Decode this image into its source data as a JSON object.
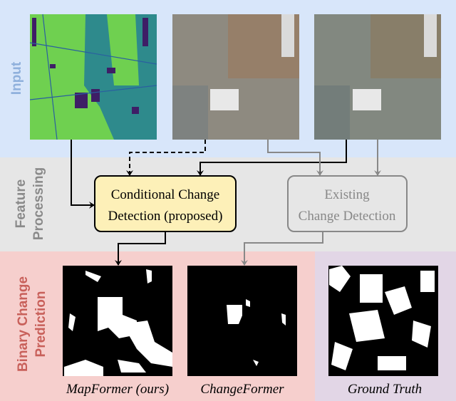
{
  "rows": {
    "input": {
      "label": "Input",
      "color": "#8fb0dc",
      "bg": "#d8e6fa"
    },
    "feature": {
      "label_line1": "Feature",
      "label_line2": "Processing",
      "color": "#8a8a8a",
      "bg": "#e6e6e6"
    },
    "prediction": {
      "label_line1": "Binary Change",
      "label_line2": "Prediction",
      "color": "#c8605a",
      "bg": "#f6cfcd",
      "gt_bg": "#e2d6e6"
    }
  },
  "inputs": [
    {
      "name": "map"
    },
    {
      "name": "image-before"
    },
    {
      "name": "image-after"
    }
  ],
  "boxes": {
    "proposed": {
      "line1": "Conditional Change",
      "line2": "Detection (proposed)",
      "fill": "#fdf0b8"
    },
    "existing": {
      "line1": "Existing",
      "line2": "Change Detection"
    }
  },
  "outputs": [
    {
      "caption": "MapFormer (ours)"
    },
    {
      "caption": "ChangeFormer"
    },
    {
      "caption": "Ground Truth"
    }
  ]
}
